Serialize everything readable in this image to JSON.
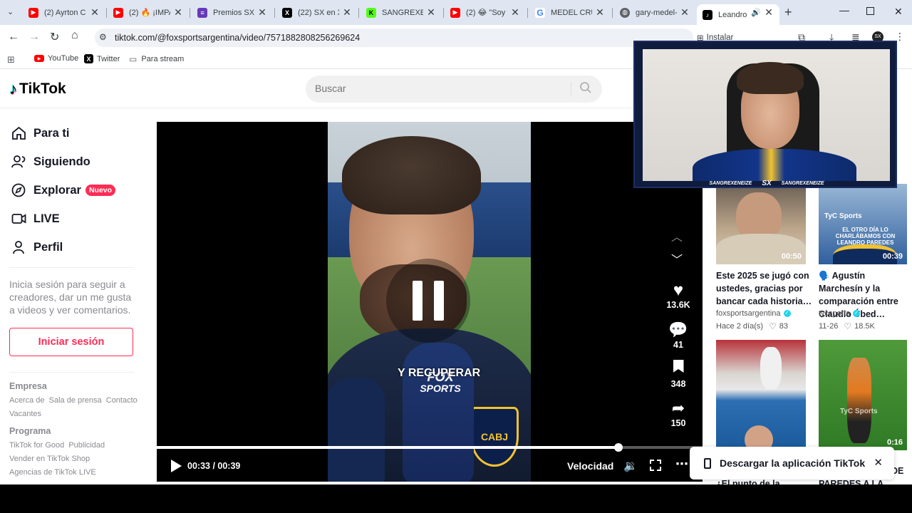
{
  "tabs": [
    {
      "title": "(2) Ayrton Co",
      "icon": "youtube-icon"
    },
    {
      "title": "(2) 🔥 ¡IMPA",
      "icon": "youtube-icon"
    },
    {
      "title": "Premios SX 2",
      "icon": "forms-icon"
    },
    {
      "title": "(22) SX en X:",
      "icon": "x-icon"
    },
    {
      "title": "SANGREXENE",
      "icon": "kick-icon"
    },
    {
      "title": "(2) 😂 \"Soy C",
      "icon": "youtube-icon"
    },
    {
      "title": "MEDEL CRUZ",
      "icon": "google-icon"
    },
    {
      "title": "gary-medel-l",
      "icon": "globe-icon"
    },
    {
      "title": "Leandro",
      "icon": "tiktok-icon"
    }
  ],
  "url": "tiktok.com/@foxsportsargentina/video/7571882808256269624",
  "install_label": "Instalar",
  "bookmarks": [
    {
      "label": "YouTube",
      "icon": "youtube-icon"
    },
    {
      "label": "Twitter",
      "icon": "x-icon"
    },
    {
      "label": "Para stream",
      "icon": "folder-icon"
    }
  ],
  "logo": "TikTok",
  "search_placeholder": "Buscar",
  "nav": [
    {
      "label": "Para ti",
      "icon": "home-icon"
    },
    {
      "label": "Siguiendo",
      "icon": "following-icon"
    },
    {
      "label": "Explorar",
      "icon": "compass-icon",
      "badge": "Nuevo"
    },
    {
      "label": "LIVE",
      "icon": "live-icon"
    },
    {
      "label": "Perfil",
      "icon": "profile-icon"
    }
  ],
  "login_prompt": "Inicia sesión para seguir a creadores, dar un me gusta a videos y ver comentarios.",
  "login_button": "Iniciar sesión",
  "footer": {
    "empresa_heading": "Empresa",
    "empresa_links_1": "Acerca de  Sala de prensa  Contacto",
    "empresa_links_2": "Vacantes",
    "programa_heading": "Programa",
    "programa_links_1": "TikTok for Good  Publicidad",
    "programa_links_2": "Vender en TikTok Shop",
    "programa_links_3": "Agencias de TikTok LIVE"
  },
  "video": {
    "subtitle": "Y RECUPERAR",
    "mic_brand_1": "FOX",
    "mic_brand_2": "SPORTS",
    "badge": "CABJ",
    "time": "00:33 / 00:39",
    "speed_label": "Velocidad",
    "progress": 0.846
  },
  "actions": {
    "likes": "13.6K",
    "comments": "41",
    "saves": "348",
    "shares": "150"
  },
  "related": [
    {
      "duration": "00:50",
      "caption": "Este 2025 se jugó con ustedes, gracias por bancar cada historia…",
      "author": "foxsportsargentina",
      "date": "Hace 2 día(s)",
      "likes": "83"
    },
    {
      "duration": "00:39",
      "caption": "🗣️ Agustín Marchesín y la comparación entre Claudio Úbed…",
      "author": "tycsports",
      "date": "11-26",
      "likes": "18.5K",
      "overlay": "EL OTRO DÍA LO CHARLÁBAMOS CON LEANDRO PAREDES",
      "brand": "TyC Sports"
    },
    {
      "duration": "",
      "caption": "¿El punto de la Copa…"
    },
    {
      "duration": "0:16",
      "caption": "PAREDES A LA…",
      "brand": "TyC Sports",
      "overlay2": "DE"
    }
  ],
  "download_banner": "Descargar la aplicación TikTok",
  "webcam": {
    "handle_left": "SANGREXENEIZE",
    "logo": "SX",
    "handle_right": "SANGREXENEIZE"
  }
}
